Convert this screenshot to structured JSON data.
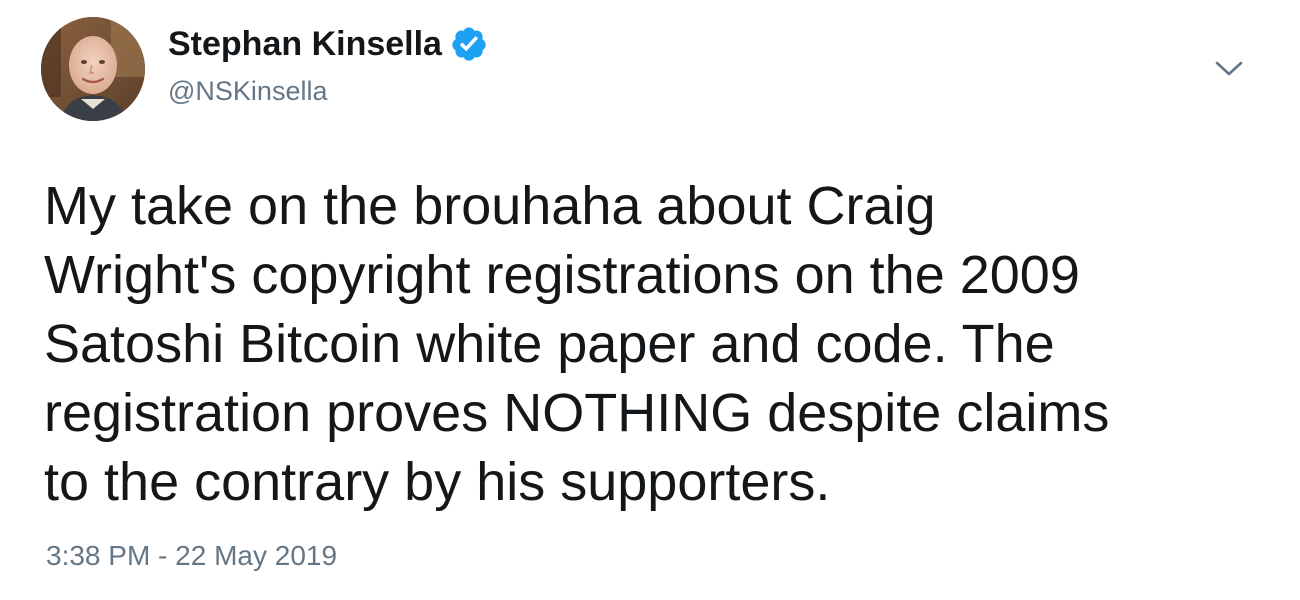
{
  "tweet": {
    "author": {
      "display_name": "Stephan Kinsella",
      "handle": "@NSKinsella",
      "verified": true,
      "avatar_icon": "profile-photo"
    },
    "menu_icon": "chevron-down-icon",
    "text": "My take on the brouhaha about Craig\nWright's copyright registrations on the 2009\nSatoshi Bitcoin white paper and code. The\nregistration proves NOTHING despite claims\nto the contrary by his supporters.",
    "timestamp": "3:38 PM - 22 May 2019"
  },
  "colors": {
    "text_primary": "#14171a",
    "text_secondary": "#657786",
    "verified_blue": "#1da1f2"
  }
}
